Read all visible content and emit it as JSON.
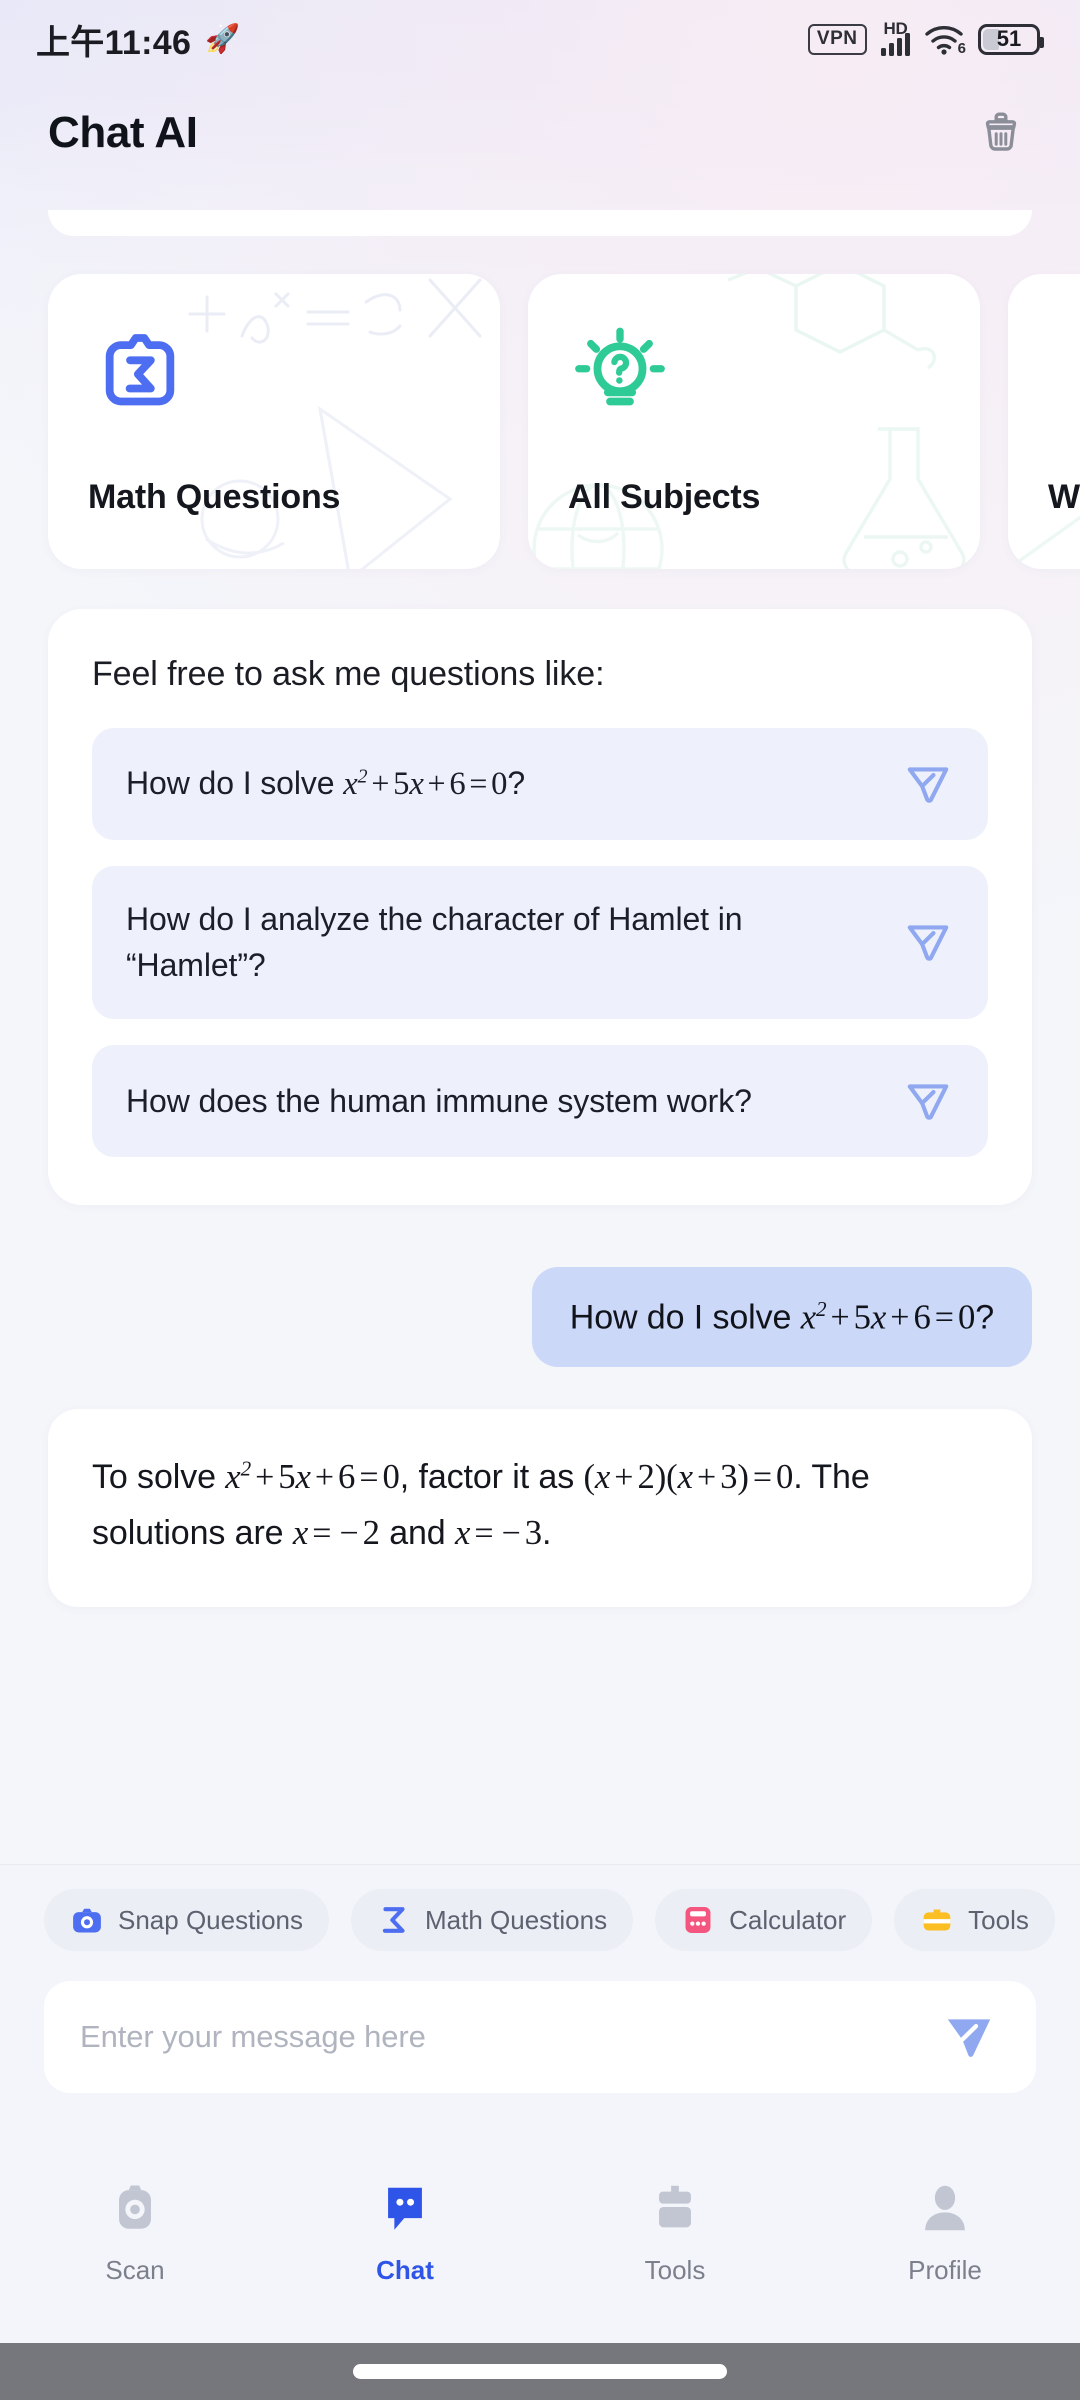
{
  "status_bar": {
    "time": "上午11:46",
    "rocket_icon": "rocket-icon",
    "vpn_label": "VPN",
    "hd_label": "HD",
    "wifi_generation": "6",
    "battery_level": "51"
  },
  "header": {
    "title": "Chat AI",
    "clear_icon": "broom-icon"
  },
  "feature_cards": [
    {
      "label": "Math Questions",
      "icon": "camera-sigma-icon",
      "accent": "#4e6ef2"
    },
    {
      "label": "All Subjects",
      "icon": "lightbulb-question-icon",
      "accent": "#2ecb96"
    },
    {
      "label": "W",
      "icon": "writing-icon",
      "accent": "#2ecb96"
    }
  ],
  "suggestions": {
    "intro": "Feel free to ask me questions like:",
    "items": [
      {
        "text_plain": "How do I solve x² + 5x + 6 = 0?",
        "send_icon": "send-outline-icon"
      },
      {
        "text_plain": "How do I analyze the character of Hamlet in “Hamlet”?",
        "send_icon": "send-outline-icon"
      },
      {
        "text_plain": "How does the human immune system work?",
        "send_icon": "send-outline-icon"
      }
    ]
  },
  "conversation": [
    {
      "role": "user",
      "text_plain": "How do I solve x² + 5x + 6 = 0?"
    },
    {
      "role": "assistant",
      "text_plain": "To solve x² + 5x + 6 = 0, factor it as (x + 2)(x + 3) = 0. The solutions are x = −2 and x = −3."
    }
  ],
  "quick_chips": [
    {
      "label": "Snap Questions",
      "icon": "camera-icon",
      "color": "#4e6ef2"
    },
    {
      "label": "Math Questions",
      "icon": "sigma-icon",
      "color": "#4e6ef2"
    },
    {
      "label": "Calculator",
      "icon": "calculator-icon",
      "color": "#f4567f"
    },
    {
      "label": "Tools",
      "icon": "toolbox-icon",
      "color": "#fbbf24"
    }
  ],
  "composer": {
    "placeholder": "Enter your message here",
    "send_icon": "send-filled-icon"
  },
  "bottom_nav": {
    "active": "Chat",
    "items": [
      {
        "label": "Scan",
        "icon": "camera-icon"
      },
      {
        "label": "Chat",
        "icon": "chat-bubble-icon"
      },
      {
        "label": "Tools",
        "icon": "toolbox-icon"
      },
      {
        "label": "Profile",
        "icon": "person-icon"
      }
    ]
  },
  "colors": {
    "accent_blue": "#2f55e8",
    "icon_blue": "#4e6ef2",
    "green": "#2ecb96",
    "pink": "#f4567f",
    "yellow": "#fbbf24",
    "user_bubble": "#ccd8f8",
    "suggestion_bg": "#eef1fc"
  }
}
